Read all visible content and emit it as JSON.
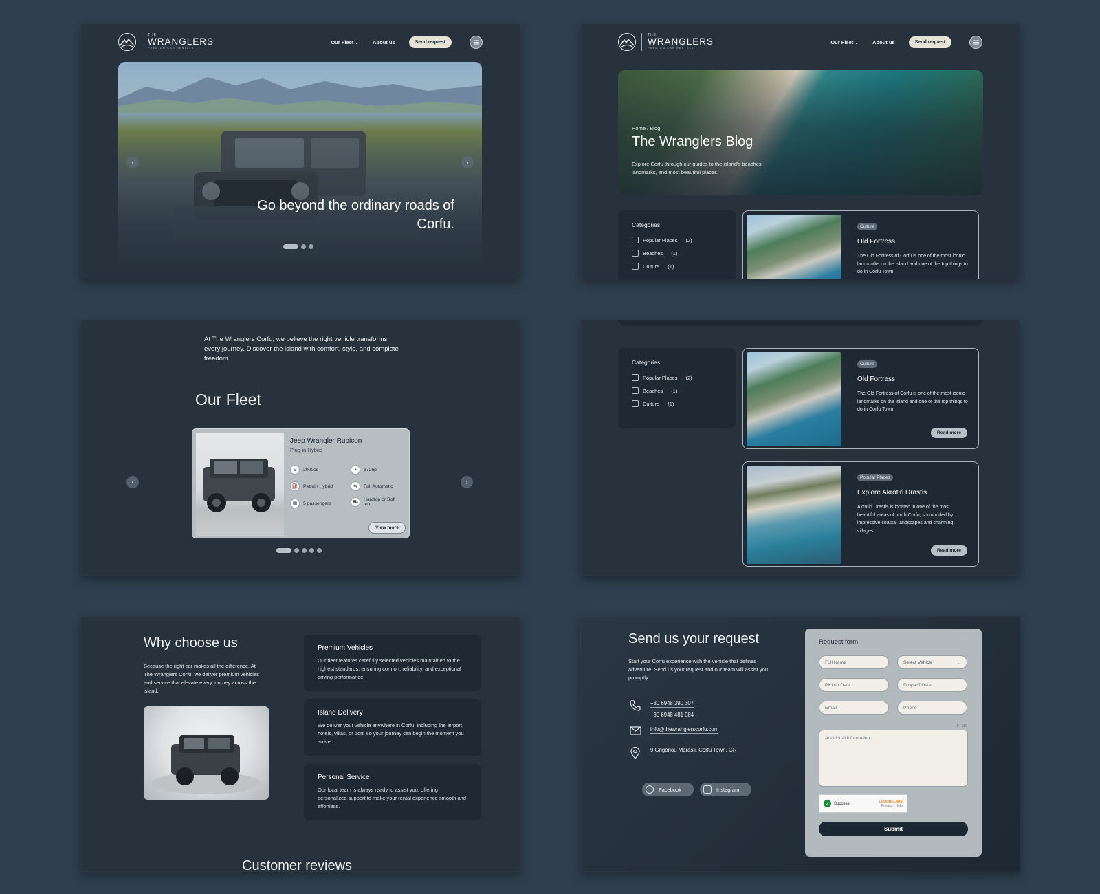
{
  "brand": {
    "the": "THE",
    "name": "WRANGLERS",
    "tagline": "PREMIUM CAR RENTALS"
  },
  "nav": {
    "fleet": "Our Fleet",
    "about": "About us",
    "request": "Send request",
    "menu_icon": "menu-icon"
  },
  "hero": {
    "caption": "Go beyond the ordinary roads of Corfu."
  },
  "blog": {
    "breadcrumb": "Home / Blog",
    "title": "The Wranglers Blog",
    "description": "Explore Corfu through our guides to the island's beaches, landmarks, and most beautiful places."
  },
  "categories": {
    "title": "Categories",
    "items": [
      {
        "label": "Popular Places",
        "count": "(2)"
      },
      {
        "label": "Beaches",
        "count": "(1)"
      },
      {
        "label": "Culture",
        "count": "(1)"
      }
    ]
  },
  "posts": [
    {
      "tag": "Culture",
      "title": "Old Fortress",
      "desc": "The Old Fortress of Corfu is one of the most iconic landmarks on the island and one of the top things to do in Corfu Town.",
      "more": "Read more"
    },
    {
      "tag": "Popular Places",
      "title": "Explore Akrotiri Drastis",
      "desc": "Akrotiri Drastis is located in one of the most beautiful areas of north Corfu, surrounded by impressive coastal landscapes and charming villages.",
      "more": "Read more"
    }
  ],
  "about_intro": "At The Wranglers Corfu, we believe the right vehicle transforms every journey. Discover the island with comfort, style, and complete freedom.",
  "fleet": {
    "title": "Our Fleet",
    "car": {
      "name": "Jeep Wrangler Rubicon",
      "sub": "Plug-in Hybrid",
      "specs": [
        {
          "icon": "engine-icon",
          "label": "2000cc"
        },
        {
          "icon": "gauge-icon",
          "label": "372hp"
        },
        {
          "icon": "fuel-icon",
          "label": "Petrol / Hybrid"
        },
        {
          "icon": "transmission-icon",
          "label": "Full Automatic"
        },
        {
          "icon": "seat-icon",
          "label": "5 passengers"
        },
        {
          "icon": "car-roof-icon",
          "label": "Hardtop or Soft top"
        }
      ],
      "cta": "View more"
    }
  },
  "why": {
    "title": "Why choose us",
    "desc": "Because the right car makes all the difference. At The Wranglers Corfu, we deliver premium vehicles and service that elevate every journey across the island.",
    "features": [
      {
        "title": "Premium Vehicles",
        "desc": "Our fleet features carefully selected vehicles maintained to the highest standards, ensuring comfort, reliability, and exceptional driving performance."
      },
      {
        "title": "Island Delivery",
        "desc": "We deliver your vehicle anywhere in Corfu, including the airport, hotels, villas, or port, so your journey can begin the moment you arrive."
      },
      {
        "title": "Personal Service",
        "desc": "Our local team is always ready to assist you, offering personalized support to make your rental experience smooth and effortless."
      }
    ],
    "reviews_title": "Customer reviews"
  },
  "contact": {
    "title": "Send us your request",
    "desc": "Start your Corfu experience with the vehicle that defines adventure. Send us your request and our team will assist you promptly.",
    "phone1": "+30 6948 390 307",
    "phone2": "+30 6948 481 984",
    "email": "info@thewranglerscorfu.com",
    "address": "9 Grigoriou Marasli, Corfu Town, GR",
    "facebook": "Facebook",
    "instagram": "Instagram"
  },
  "form": {
    "title": "Request form",
    "full_name": "Full Name",
    "vehicle": "Select Vehicle",
    "pickup": "Pickup Date",
    "dropoff": "Drop-off Date",
    "email": "Email",
    "phone": "Phone",
    "counter": "0 / 180",
    "info": "Additional information",
    "captcha_status": "Success!",
    "captcha_brand": "CLOUDFLARE",
    "captcha_links": "Privacy • Help",
    "submit": "Submit"
  },
  "colors": {
    "background": "#2f3f4f",
    "panel": "#27323d",
    "card": "#1e2934",
    "accent_button": "#e7e2d6"
  }
}
